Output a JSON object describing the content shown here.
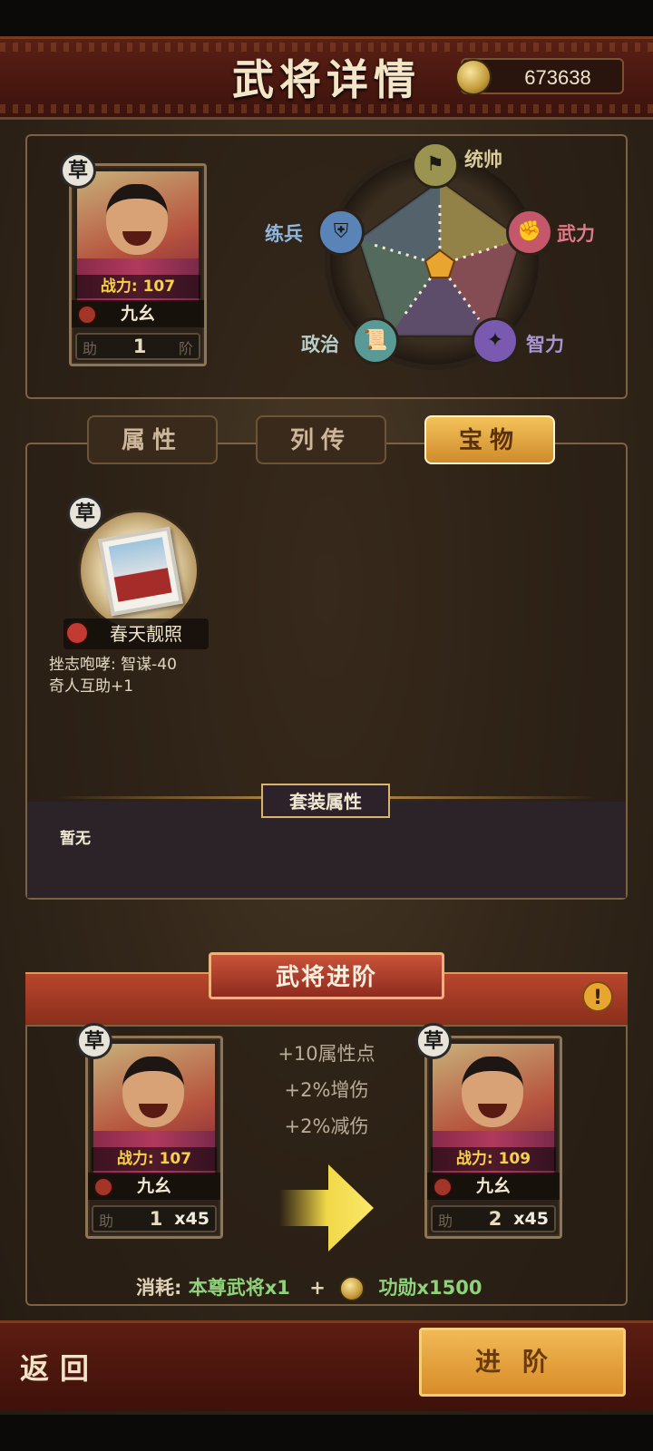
{
  "header": {
    "title": "武将详情",
    "currency": "673638"
  },
  "hero_card": {
    "grade": "草",
    "power": "战力: 107",
    "name": "九幺",
    "level": "1",
    "left_mark": "助",
    "right_mark": "阶"
  },
  "radar": {
    "stats": [
      {
        "label": "统帅",
        "icon": "flag-icon",
        "color": "#8a8a4a"
      },
      {
        "label": "武力",
        "icon": "fist-icon",
        "color": "#c4586a"
      },
      {
        "label": "智力",
        "icon": "brain-icon",
        "color": "#6a4a9a"
      },
      {
        "label": "政治",
        "icon": "scroll-icon",
        "color": "#4e8a8a"
      },
      {
        "label": "练兵",
        "icon": "armor-icon",
        "color": "#4a6e9a"
      }
    ],
    "center_icon": "sun-icon"
  },
  "tabs": [
    {
      "label": "属性",
      "active": false
    },
    {
      "label": "列传",
      "active": false
    },
    {
      "label": "宝物",
      "active": true
    }
  ],
  "treasure": {
    "grade": "草",
    "name": "春天靓照",
    "effects": [
      "挫志咆哮: 智谋-40",
      "奇人互助+1"
    ]
  },
  "set_bonus": {
    "title": "套装属性",
    "value": "暂无"
  },
  "advance": {
    "title": "武将进阶",
    "bonuses": [
      "+10属性点",
      "+2%增伤",
      "+2%减伤"
    ],
    "before": {
      "grade": "草",
      "power": "战力: 107",
      "name": "九幺",
      "level": "1",
      "count": "x45",
      "left_mark": "助",
      "right_mark": "阶"
    },
    "after": {
      "grade": "草",
      "power": "战力: 109",
      "name": "九幺",
      "level": "2",
      "count": "x45",
      "left_mark": "助",
      "right_mark": "阶"
    },
    "cost_label": "消耗:",
    "cost_item": "本尊武将x1",
    "plus": "+",
    "cost_currency": "功勋x1500"
  },
  "footer": {
    "back": "返回",
    "advance_button": "进阶"
  }
}
